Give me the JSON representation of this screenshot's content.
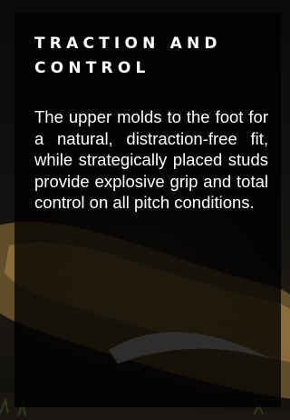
{
  "panel": {
    "heading": "TRACTION AND CONTROL",
    "body": "The upper molds to the foot for a natural, distraction-free fit, while strategically placed studs provide explosive grip and total control on all pitch conditions."
  },
  "background": {
    "image": "football-boot-icon",
    "boot_color": "#b08a4a",
    "logo_color": "#dcdcdc"
  },
  "colors": {
    "text": "#ffffff",
    "overlay": "#000000"
  }
}
